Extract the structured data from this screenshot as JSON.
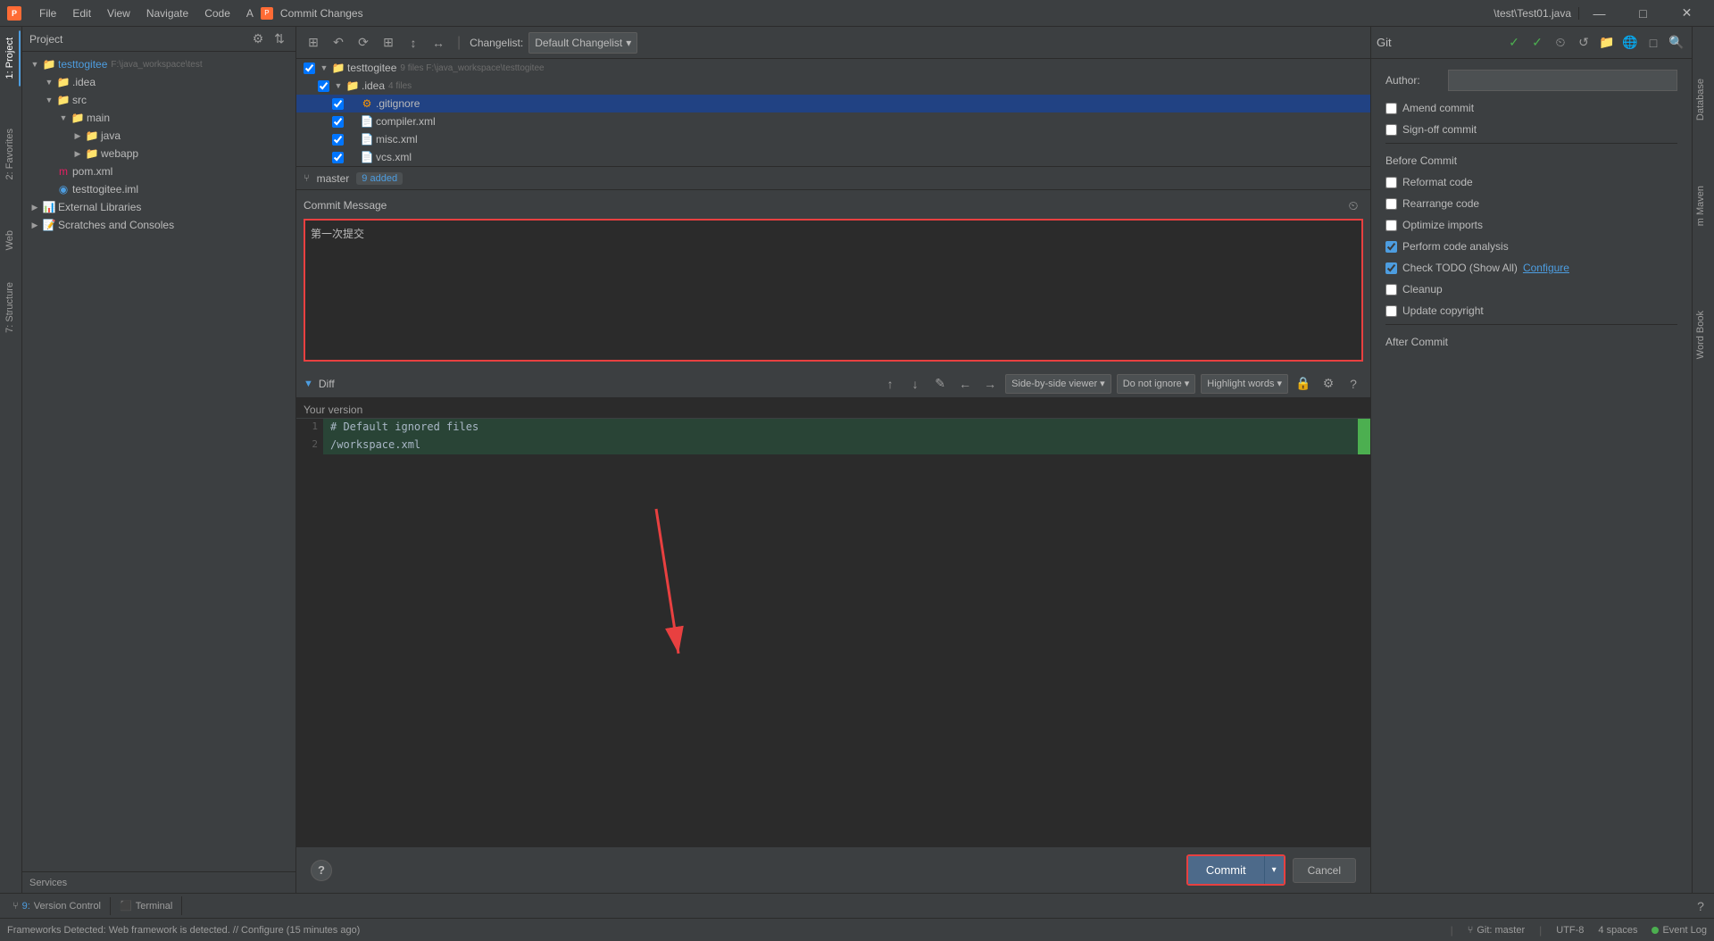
{
  "titlebar": {
    "app_icon": "P",
    "menus": [
      "File",
      "Edit",
      "View",
      "Navigate",
      "Code",
      "A"
    ],
    "dialog_icon": "P",
    "dialog_title": "Commit Changes",
    "window_title": "\\test\\Test01.java",
    "win_buttons": [
      "—",
      "□",
      "✕"
    ]
  },
  "sidebar": {
    "project_label": "Project",
    "root_item": "testtogitee",
    "items": [
      {
        "label": "testtogitee",
        "path": "F:\\java_workspace\\test",
        "indent": 0,
        "type": "root",
        "expanded": true
      },
      {
        "label": ".idea",
        "indent": 1,
        "type": "folder",
        "expanded": true
      },
      {
        "label": "src",
        "indent": 1,
        "type": "folder",
        "expanded": true
      },
      {
        "label": "main",
        "indent": 2,
        "type": "folder",
        "expanded": true
      },
      {
        "label": "java",
        "indent": 3,
        "type": "folder"
      },
      {
        "label": "webapp",
        "indent": 3,
        "type": "folder"
      },
      {
        "label": "pom.xml",
        "indent": 1,
        "type": "file-maven"
      },
      {
        "label": "testtogitee.iml",
        "indent": 1,
        "type": "file-iml"
      },
      {
        "label": "External Libraries",
        "indent": 0,
        "type": "lib"
      },
      {
        "label": "Scratches and Consoles",
        "indent": 0,
        "type": "scratches"
      }
    ]
  },
  "left_sidebar_tabs": [
    "1: Project"
  ],
  "right_sidebar_tabs": [
    "Database",
    "m Maven",
    "Word Book"
  ],
  "dialog": {
    "toolbar": {
      "buttons": [
        "↶",
        "↷",
        "⟳",
        "⊞",
        "↕",
        "↔"
      ],
      "changelist_label": "Changelist:",
      "changelist_value": "Default Changelist",
      "git_label": "Git"
    },
    "file_tree": {
      "root": "testtogitee",
      "root_count": "9 files",
      "root_path": "F:\\java_workspace\\testtogitee",
      "idea_folder": ".idea",
      "idea_count": "4 files",
      "files": [
        {
          "name": ".gitignore",
          "type": "git",
          "checked": true,
          "selected": true
        },
        {
          "name": "compiler.xml",
          "type": "xml",
          "checked": true
        },
        {
          "name": "misc.xml",
          "type": "xml",
          "checked": true
        },
        {
          "name": "vcs.xml",
          "type": "xml",
          "checked": true
        }
      ]
    },
    "branch": {
      "icon": "⑂",
      "name": "master",
      "badge": "9 added"
    },
    "commit_message": {
      "label": "Commit Message",
      "text": "第一次提交",
      "placeholder": ""
    },
    "diff": {
      "label": "Diff",
      "toolbar": {
        "up_btn": "↑",
        "down_btn": "↓",
        "edit_btn": "✎",
        "prev_btn": "←",
        "next_btn": "→",
        "viewer_label": "Side-by-side viewer",
        "ignore_label": "Do not ignore",
        "highlight_label": "Highlight words"
      },
      "your_version": "Your version",
      "lines": [
        {
          "num": 1,
          "content": "# Default ignored files",
          "type": "added"
        },
        {
          "num": 2,
          "content": "/workspace.xml",
          "type": "added"
        }
      ]
    },
    "bottom": {
      "help_btn": "?",
      "commit_btn": "Commit",
      "dropdown_arrow": "▾",
      "cancel_btn": "Cancel"
    }
  },
  "git_panel": {
    "title": "Git",
    "toolbar_icons": [
      "✓",
      "✓",
      "⏲",
      "↺",
      "📁",
      "🌐",
      "□",
      "🔍"
    ],
    "author_label": "Author:",
    "author_value": "",
    "amend_label": "Amend commit",
    "amend_checked": false,
    "signoff_label": "Sign-off commit",
    "signoff_checked": false,
    "before_commit_label": "Before Commit",
    "options": [
      {
        "label": "Reformat code",
        "checked": false
      },
      {
        "label": "Rearrange code",
        "checked": false
      },
      {
        "label": "Optimize imports",
        "checked": false
      },
      {
        "label": "Perform code analysis",
        "checked": true
      },
      {
        "label": "Check TODO (Show All)",
        "checked": true,
        "link": "Configure"
      },
      {
        "label": "Cleanup",
        "checked": false
      },
      {
        "label": "Update copyright",
        "checked": false
      }
    ],
    "after_commit_label": "After Commit"
  },
  "status_bar": {
    "encoding": "UTF-8",
    "spaces": "4 spaces",
    "git_branch": "Git: master",
    "event_log": "Event Log",
    "notification": "Frameworks Detected: Web framework is detected. // Configure (15 minutes ago)"
  },
  "bottom_bar": {
    "tabs": [
      {
        "number": "9",
        "label": "Version Control"
      },
      {
        "label": "Terminal"
      }
    ]
  },
  "colors": {
    "accent": "#4d9de0",
    "warning": "#e84040",
    "added": "#4caf50",
    "bg_dark": "#2b2b2b",
    "bg_medium": "#3c3f41",
    "selected": "#214283"
  }
}
